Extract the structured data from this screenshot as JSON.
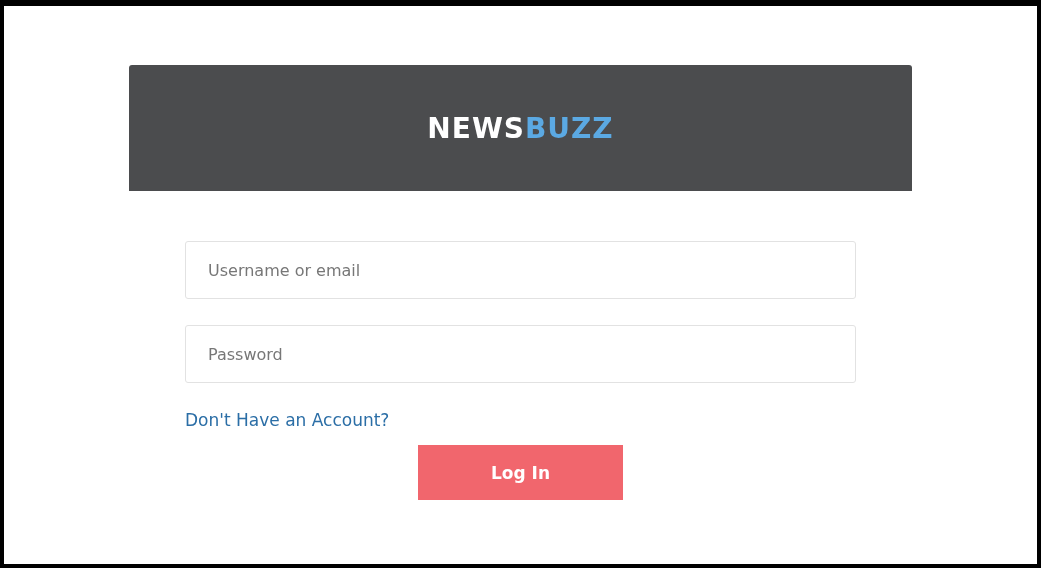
{
  "header": {
    "logo_first": "NEWS",
    "logo_second": "BUZZ"
  },
  "fields": [
    {
      "placeholder": "Username or email"
    },
    {
      "placeholder": "Password"
    }
  ],
  "signup_link": "Don't Have an Account?",
  "login_button": "Log In"
}
